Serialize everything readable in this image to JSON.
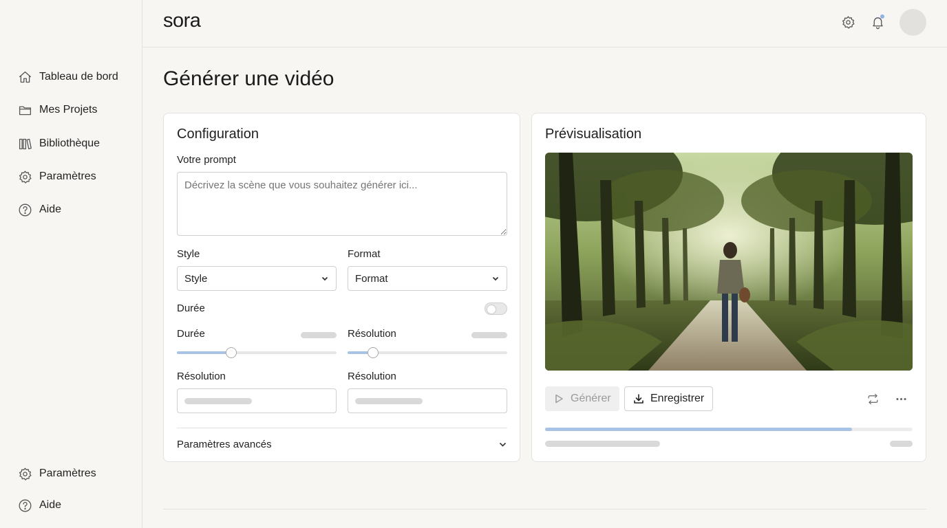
{
  "app": {
    "name": "sora"
  },
  "sidebar": {
    "items": [
      {
        "label": "Tableau de bord",
        "icon": "home-icon"
      },
      {
        "label": "Mes Projets",
        "icon": "folder-icon"
      },
      {
        "label": "Bibliothèque",
        "icon": "library-icon"
      },
      {
        "label": "Paramètres",
        "icon": "gear-icon"
      },
      {
        "label": "Aide",
        "icon": "help-icon"
      }
    ],
    "footer_items": [
      {
        "label": "Paramètres",
        "icon": "gear-icon"
      },
      {
        "label": "Aide",
        "icon": "help-icon"
      }
    ]
  },
  "header": {
    "icons": [
      "gear-icon",
      "bell-icon"
    ],
    "has_notification": true
  },
  "page": {
    "title": "Générer une vidéo"
  },
  "config": {
    "title": "Configuration",
    "prompt_label": "Votre prompt",
    "prompt_placeholder": "Décrivez la scène que vous souhaitez générer ici...",
    "style_label": "Style",
    "style_value": "Style",
    "format_label": "Format",
    "format_value": "Format",
    "duration_toggle_label": "Durée",
    "duration_toggle_on": false,
    "duration_slider_label": "Durée",
    "duration_slider_level": 0.34,
    "resolution_slider_label": "Résolution",
    "resolution_slider_level": 0.16,
    "resolution_input_label_1": "Résolution",
    "resolution_input_label_2": "Résolution",
    "advanced_label": "Paramètres avancés"
  },
  "preview": {
    "title": "Prévisualisation",
    "generate_label": "Générer",
    "save_label": "Enregistrer",
    "progress": 0.835
  },
  "colors": {
    "accent": "#a9c3e6",
    "background": "#f7f6f3"
  }
}
